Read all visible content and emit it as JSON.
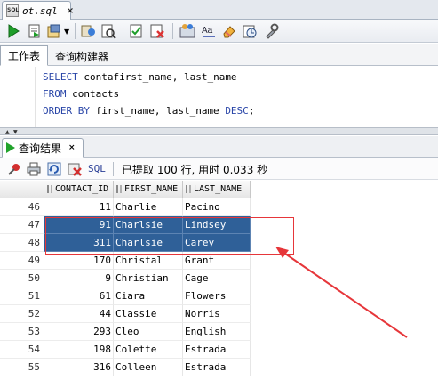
{
  "document_tab": {
    "label": "ot.sql",
    "badge": "SQL"
  },
  "toolbar": {
    "icons": [
      "run-statement-icon",
      "run-script-icon",
      "commit-icon",
      "rollback-icon",
      "explain-plan-icon",
      "autotrace-icon",
      "sql-tuning-icon",
      "unshared-sql-icon",
      "format-icon",
      "eraser-icon",
      "history-icon",
      "tools-icon"
    ]
  },
  "editor_tabs": {
    "worksheet": "工作表",
    "query_builder": "查询构建器"
  },
  "editor": {
    "lines": [
      {
        "keyword": "SELECT",
        "rest": " contafirst_name, last_name"
      },
      {
        "keyword": "FROM",
        "rest": " contacts"
      },
      {
        "keyword": "ORDER BY",
        "rest": " first_name, last_name ",
        "keyword2": "DESC",
        "tail": ";"
      }
    ]
  },
  "results": {
    "tab_label": "查询结果",
    "sql_label": "SQL",
    "status": "已提取 100 行, 用时 0.033 秒"
  },
  "grid": {
    "columns": [
      "CONTACT_ID",
      "FIRST_NAME",
      "LAST_NAME"
    ],
    "rows": [
      {
        "rn": "46",
        "id": "11",
        "first": "Charlie",
        "last": "Pacino"
      },
      {
        "rn": "47",
        "id": "91",
        "first": "Charlsie",
        "last": "Lindsey",
        "selected": true
      },
      {
        "rn": "48",
        "id": "311",
        "first": "Charlsie",
        "last": "Carey",
        "selected": true
      },
      {
        "rn": "49",
        "id": "170",
        "first": "Christal",
        "last": "Grant"
      },
      {
        "rn": "50",
        "id": "9",
        "first": "Christian",
        "last": "Cage"
      },
      {
        "rn": "51",
        "id": "61",
        "first": "Ciara",
        "last": "Flowers"
      },
      {
        "rn": "52",
        "id": "44",
        "first": "Classie",
        "last": "Norris"
      },
      {
        "rn": "53",
        "id": "293",
        "first": "Cleo",
        "last": "English"
      },
      {
        "rn": "54",
        "id": "198",
        "first": "Colette",
        "last": "Estrada"
      },
      {
        "rn": "55",
        "id": "316",
        "first": "Colleen",
        "last": "Estrada"
      }
    ]
  },
  "colors": {
    "selection": "#2f6098",
    "annotation": "#e6363a",
    "keyword": "#2a46a8"
  }
}
